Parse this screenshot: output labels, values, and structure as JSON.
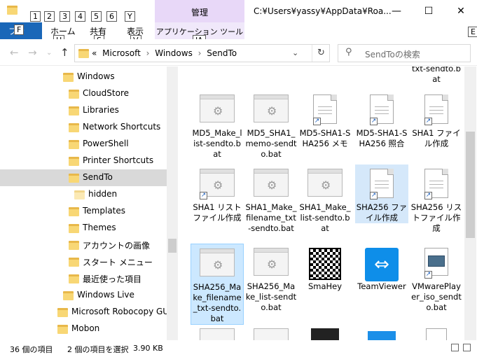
{
  "titlebar": {
    "context_tab": "管理",
    "title": "C:¥Users¥yassy¥AppData¥Roa...",
    "keytips": [
      "1",
      "2",
      "3",
      "4",
      "5",
      "6",
      "Y"
    ],
    "minimize": "—",
    "maximize": "☐",
    "close": "✕"
  },
  "ribbon": {
    "file_tab": "ファ",
    "file_keytip": "F",
    "tabs": [
      {
        "label": "ホーム",
        "keytip": "H"
      },
      {
        "label": "共有",
        "keytip": "S"
      },
      {
        "label": "表示",
        "keytip": "V"
      }
    ],
    "app_tools": "アプリケーション ツール",
    "app_tools_keytip": "JA",
    "help_keytip": "E"
  },
  "address": {
    "crumbs": [
      "Microsoft",
      "Windows",
      "SendTo"
    ],
    "overflow": "«",
    "search_placeholder": "SendToの検索"
  },
  "tree": [
    {
      "label": "Windows",
      "level": 1,
      "light": false
    },
    {
      "label": "CloudStore",
      "level": 2,
      "light": false
    },
    {
      "label": "Libraries",
      "level": 2,
      "light": false
    },
    {
      "label": "Network Shortcuts",
      "level": 2,
      "light": false
    },
    {
      "label": "PowerShell",
      "level": 2,
      "light": false
    },
    {
      "label": "Printer Shortcuts",
      "level": 2,
      "light": false
    },
    {
      "label": "SendTo",
      "level": 2,
      "light": false,
      "selected": true
    },
    {
      "label": "hidden",
      "level": 3,
      "light": true
    },
    {
      "label": "Templates",
      "level": 2,
      "light": false
    },
    {
      "label": "Themes",
      "level": 2,
      "light": false
    },
    {
      "label": "アカウントの画像",
      "level": 2,
      "light": false
    },
    {
      "label": "スタート メニュー",
      "level": 2,
      "light": false
    },
    {
      "label": "最近使った項目",
      "level": 2,
      "light": false
    },
    {
      "label": "Windows Live",
      "level": 1,
      "light": false
    },
    {
      "label": "Microsoft Robocopy GUI",
      "level": 0,
      "light": false
    },
    {
      "label": "Mobon",
      "level": 0,
      "light": false
    }
  ],
  "files": [
    {
      "name": "txt-sendto.bat",
      "icon": "partial"
    },
    {
      "name": "MD5_Make_list-sendto.bat",
      "icon": "window"
    },
    {
      "name": "MD5_SHA1_memo-sendto.bat",
      "icon": "window"
    },
    {
      "name": "MD5-SHA1-SHA256 メモ",
      "icon": "doc-shortcut"
    },
    {
      "name": "MD5-SHA1-SHA256 照合",
      "icon": "doc-shortcut"
    },
    {
      "name": "SHA1 ファイル作成",
      "icon": "doc-shortcut"
    },
    {
      "name": "SHA1 リストファイル作成",
      "icon": "window-shortcut"
    },
    {
      "name": "SHA1_Make_filename_txt-sendto.bat",
      "icon": "window"
    },
    {
      "name": "SHA1_Make_list-sendto.bat",
      "icon": "window"
    },
    {
      "name": "SHA256 ファイル作成",
      "icon": "doc-shortcut",
      "selected": true
    },
    {
      "name": "SHA256 リストファイル作成",
      "icon": "doc-shortcut"
    },
    {
      "name": "SHA256_Make_filename_txt-sendto.bat",
      "icon": "window",
      "selected": true
    },
    {
      "name": "SHA256_Make_list-sendto.bat",
      "icon": "window"
    },
    {
      "name": "SmaHey",
      "icon": "qr"
    },
    {
      "name": "TeamViewer",
      "icon": "teamviewer"
    },
    {
      "name": "VMwarePlayer_iso_sendto.bat",
      "icon": "vmware"
    }
  ],
  "status": {
    "count": "36 個の項目",
    "selected": "2 個の項目を選択",
    "size": "3.90 KB"
  }
}
